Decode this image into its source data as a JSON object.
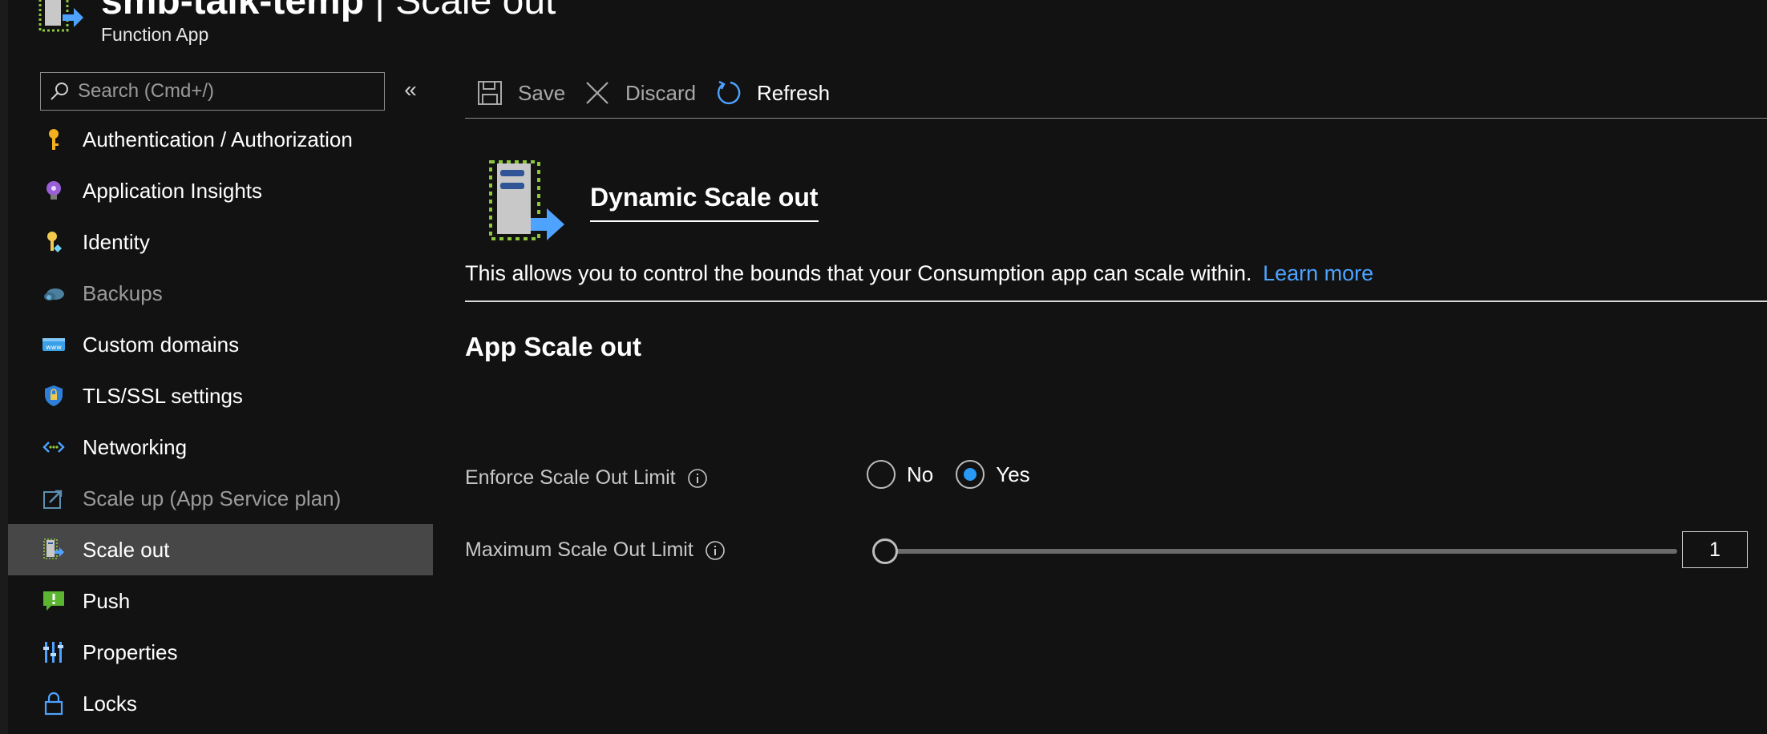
{
  "header": {
    "resource_name": "smb-talk-temp",
    "separator": "|",
    "page_name": "Scale out",
    "resource_type": "Function App"
  },
  "sidebar": {
    "search_placeholder": "Search (Cmd+/)",
    "collapse_label": "«",
    "items": [
      {
        "label": "Authentication / Authorization",
        "icon": "key-icon",
        "dim": false,
        "active": false
      },
      {
        "label": "Application Insights",
        "icon": "lightbulb-icon",
        "dim": false,
        "active": false
      },
      {
        "label": "Identity",
        "icon": "identity-key-icon",
        "dim": false,
        "active": false
      },
      {
        "label": "Backups",
        "icon": "cloud-backup-icon",
        "dim": true,
        "active": false
      },
      {
        "label": "Custom domains",
        "icon": "www-icon",
        "dim": false,
        "active": false
      },
      {
        "label": "TLS/SSL settings",
        "icon": "shield-lock-icon",
        "dim": false,
        "active": false
      },
      {
        "label": "Networking",
        "icon": "networking-icon",
        "dim": false,
        "active": false
      },
      {
        "label": "Scale up (App Service plan)",
        "icon": "scale-up-icon",
        "dim": true,
        "active": false
      },
      {
        "label": "Scale out",
        "icon": "scale-out-icon",
        "dim": false,
        "active": true
      },
      {
        "label": "Push",
        "icon": "push-icon",
        "dim": false,
        "active": false
      },
      {
        "label": "Properties",
        "icon": "properties-icon",
        "dim": false,
        "active": false
      },
      {
        "label": "Locks",
        "icon": "lock-icon",
        "dim": false,
        "active": false
      }
    ]
  },
  "toolbar": {
    "save_label": "Save",
    "discard_label": "Discard",
    "refresh_label": "Refresh"
  },
  "main": {
    "hero_title": "Dynamic Scale out",
    "description": "This allows you to control the bounds that your Consumption app can scale within.",
    "learn_more": "Learn more",
    "section_title": "App Scale out",
    "enforce_label": "Enforce Scale Out Limit",
    "enforce_options": [
      {
        "label": "No",
        "checked": false
      },
      {
        "label": "Yes",
        "checked": true
      }
    ],
    "max_label": "Maximum Scale Out Limit",
    "max_value": "1",
    "max_slider_fraction": 0
  },
  "colors": {
    "background": "#121212",
    "accent": "#2899f5",
    "link": "#4da3ff",
    "active_item": "#474747"
  }
}
